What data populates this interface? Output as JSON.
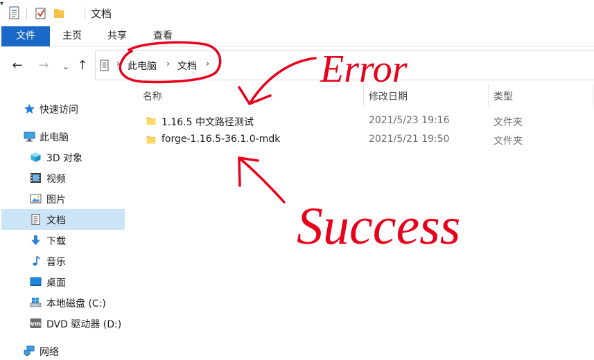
{
  "window": {
    "title": "文档"
  },
  "quick_access": {
    "icons": [
      "document-properties-icon",
      "checkbox-icon",
      "folder-icon",
      "dropdown-arrow-icon"
    ]
  },
  "ribbon": {
    "tabs": [
      {
        "label": "文件",
        "active": true
      },
      {
        "label": "主页"
      },
      {
        "label": "共享"
      },
      {
        "label": "查看"
      }
    ],
    "accent": "#1a69c8"
  },
  "navigation": {
    "back": "←",
    "forward": "→",
    "recent": "⌄",
    "up": "↑"
  },
  "address": {
    "separator": "›",
    "crumbs": [
      "此电脑",
      "文档"
    ]
  },
  "sidebar": {
    "items": [
      {
        "label": "快速访问",
        "icon": "star-icon"
      },
      {
        "label": "此电脑",
        "icon": "computer-icon"
      },
      {
        "label": "3D 对象",
        "icon": "cube-icon"
      },
      {
        "label": "视频",
        "icon": "film-icon"
      },
      {
        "label": "图片",
        "icon": "picture-icon"
      },
      {
        "label": "文档",
        "icon": "document-icon",
        "selected": true
      },
      {
        "label": "下载",
        "icon": "download-arrow-icon"
      },
      {
        "label": "音乐",
        "icon": "music-note-icon"
      },
      {
        "label": "桌面",
        "icon": "desktop-icon"
      },
      {
        "label": "本地磁盘 (C:)",
        "icon": "windows-drive-icon"
      },
      {
        "label": "DVD 驱动器 (D:)",
        "icon": "vm-drive-icon"
      },
      {
        "label": "网络",
        "icon": "network-icon"
      }
    ],
    "selected_color": "#cce4f7"
  },
  "columns": {
    "name": "名称",
    "date": "修改日期",
    "type": "类型"
  },
  "files": [
    {
      "name": "1.16.5 中文路径测试",
      "date": "2021/5/23 19:16",
      "type": "文件夹"
    },
    {
      "name": "forge-1.16.5-36.1.0-mdk",
      "date": "2021/5/21 19:50",
      "type": "文件夹"
    }
  ],
  "annotations": {
    "error_label": "Error",
    "success_label": "Success",
    "ink_color": "#e8001a"
  }
}
